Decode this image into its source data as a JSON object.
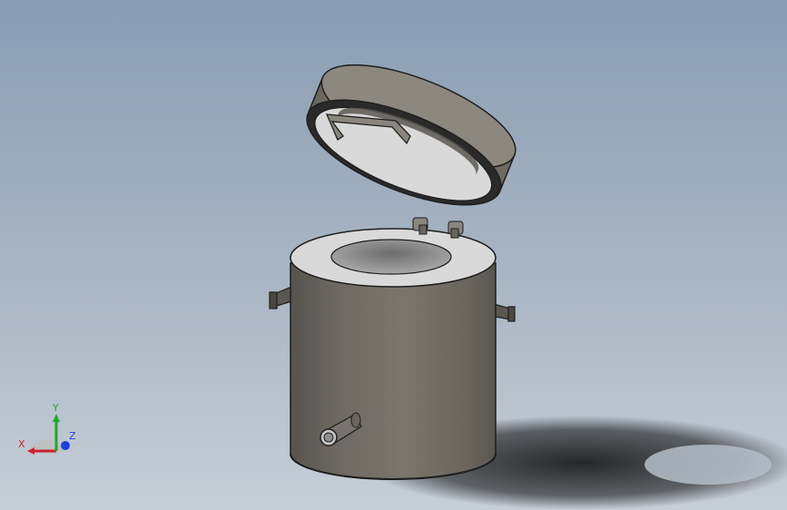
{
  "viewport": {
    "background_top": "#8a9db3",
    "background_bottom": "#c7ced6"
  },
  "model": {
    "name": "",
    "colors": {
      "body": "#6e6a63",
      "lid_inner": "#d9d9d9",
      "edge": "#1e1e1e",
      "shadow": "#111111"
    }
  },
  "triad": {
    "x_label": "X",
    "y_label": "Y",
    "z_label": "Z",
    "x_color": "#d0202a",
    "y_color": "#1fa82b",
    "z_color": "#1f3fd6"
  }
}
